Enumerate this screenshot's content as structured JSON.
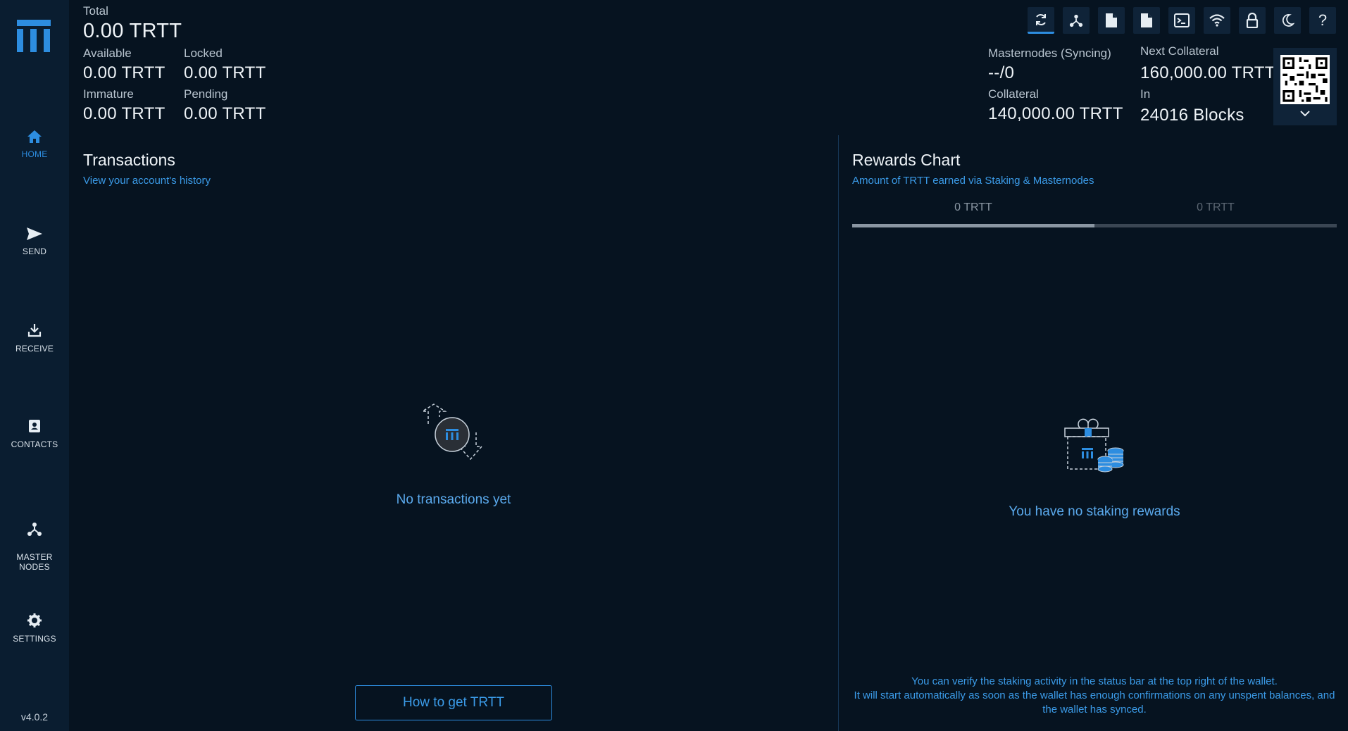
{
  "sidebar": {
    "items": [
      {
        "label": "HOME",
        "icon": "home-icon"
      },
      {
        "label": "SEND",
        "icon": "send-icon"
      },
      {
        "label": "RECEIVE",
        "icon": "receive-icon"
      },
      {
        "label": "CONTACTS",
        "icon": "contacts-icon"
      },
      {
        "label": "MASTER\nNODES",
        "icon": "masternodes-icon"
      },
      {
        "label": "SETTINGS",
        "icon": "gear-icon"
      }
    ],
    "version": "v4.0.2"
  },
  "balances": {
    "total_label": "Total",
    "total_value": "0.00 TRTT",
    "available_label": "Available",
    "available_value": "0.00 TRTT",
    "locked_label": "Locked",
    "locked_value": "0.00 TRTT",
    "immature_label": "Immature",
    "immature_value": "0.00 TRTT",
    "pending_label": "Pending",
    "pending_value": "0.00 TRTT"
  },
  "masternodes": {
    "status_label": "Masternodes (Syncing)",
    "status_value": "--/0",
    "collateral_label": "Collateral",
    "collateral_value": "140,000.00 TRTT",
    "next_collateral_label": "Next Collateral",
    "next_collateral_value": "160,000.00 TRTT",
    "in_label": "In",
    "in_value": "24016 Blocks"
  },
  "toolbar": {
    "icons": [
      "sync-icon",
      "network-icon",
      "document-icon",
      "document-icon",
      "console-icon",
      "wifi-icon",
      "lock-icon",
      "moon-icon",
      "help-icon"
    ],
    "help_glyph": "?"
  },
  "transactions": {
    "title": "Transactions",
    "subtitle": "View your account's history",
    "empty_message": "No transactions yet",
    "button_label": "How to get TRTT"
  },
  "rewards": {
    "title": "Rewards Chart",
    "subtitle": "Amount of TRTT earned via Staking & Masternodes",
    "tabs": [
      "0 TRTT",
      "0 TRTT"
    ],
    "selected_tab_fraction": 0.5,
    "empty_message": "You have no staking rewards",
    "note_line1": "You can verify the staking activity in the status bar at the top right of the wallet.",
    "note_line2": "It will start automatically as soon as the wallet has enough confirmations on any unspent balances, and the wallet has synced."
  },
  "colors": {
    "background": "#061320",
    "sidebar": "#0a1d30",
    "accent": "#2d8de0"
  }
}
